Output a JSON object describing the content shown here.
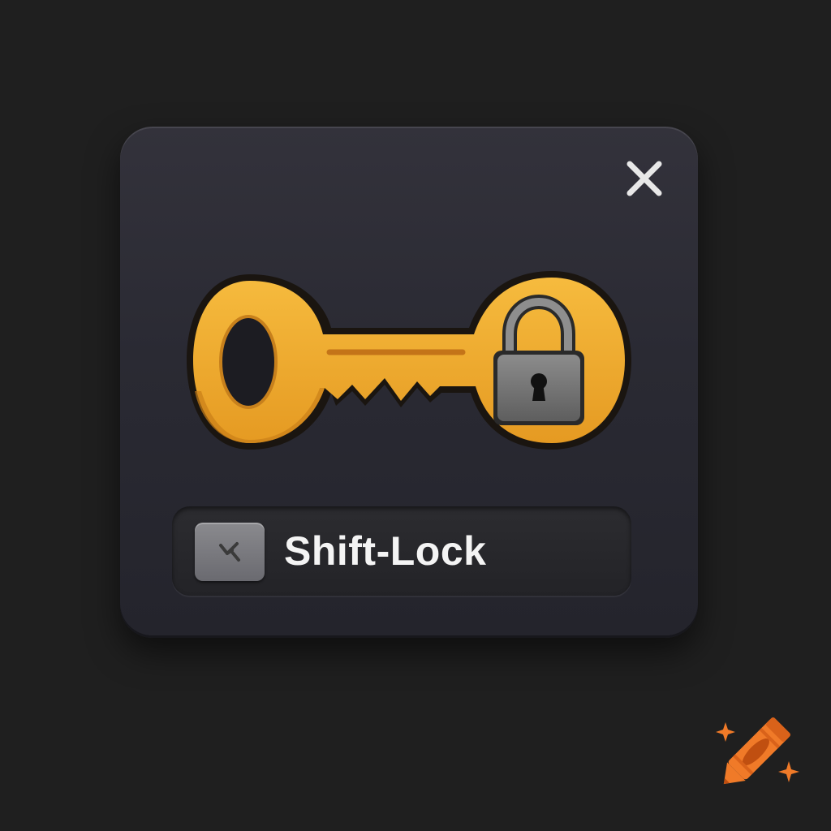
{
  "dialog": {
    "close_icon": "close-icon",
    "illustration": {
      "key_icon": "key-icon",
      "padlock_icon": "padlock-icon"
    },
    "toggle": {
      "label": "Shift-Lock",
      "checkbox_icon": "checkmark-icon",
      "checked": true
    }
  },
  "colors": {
    "page_background": "#1f1f1f",
    "dialog_background": "#2a2a33",
    "key_gold": "#f0a82c",
    "padlock_gray": "#7a7a7a",
    "label_text": "#f4f4f4",
    "brand_orange": "#f07a28"
  },
  "brand": {
    "logo_icon": "crayon-logo-icon"
  }
}
